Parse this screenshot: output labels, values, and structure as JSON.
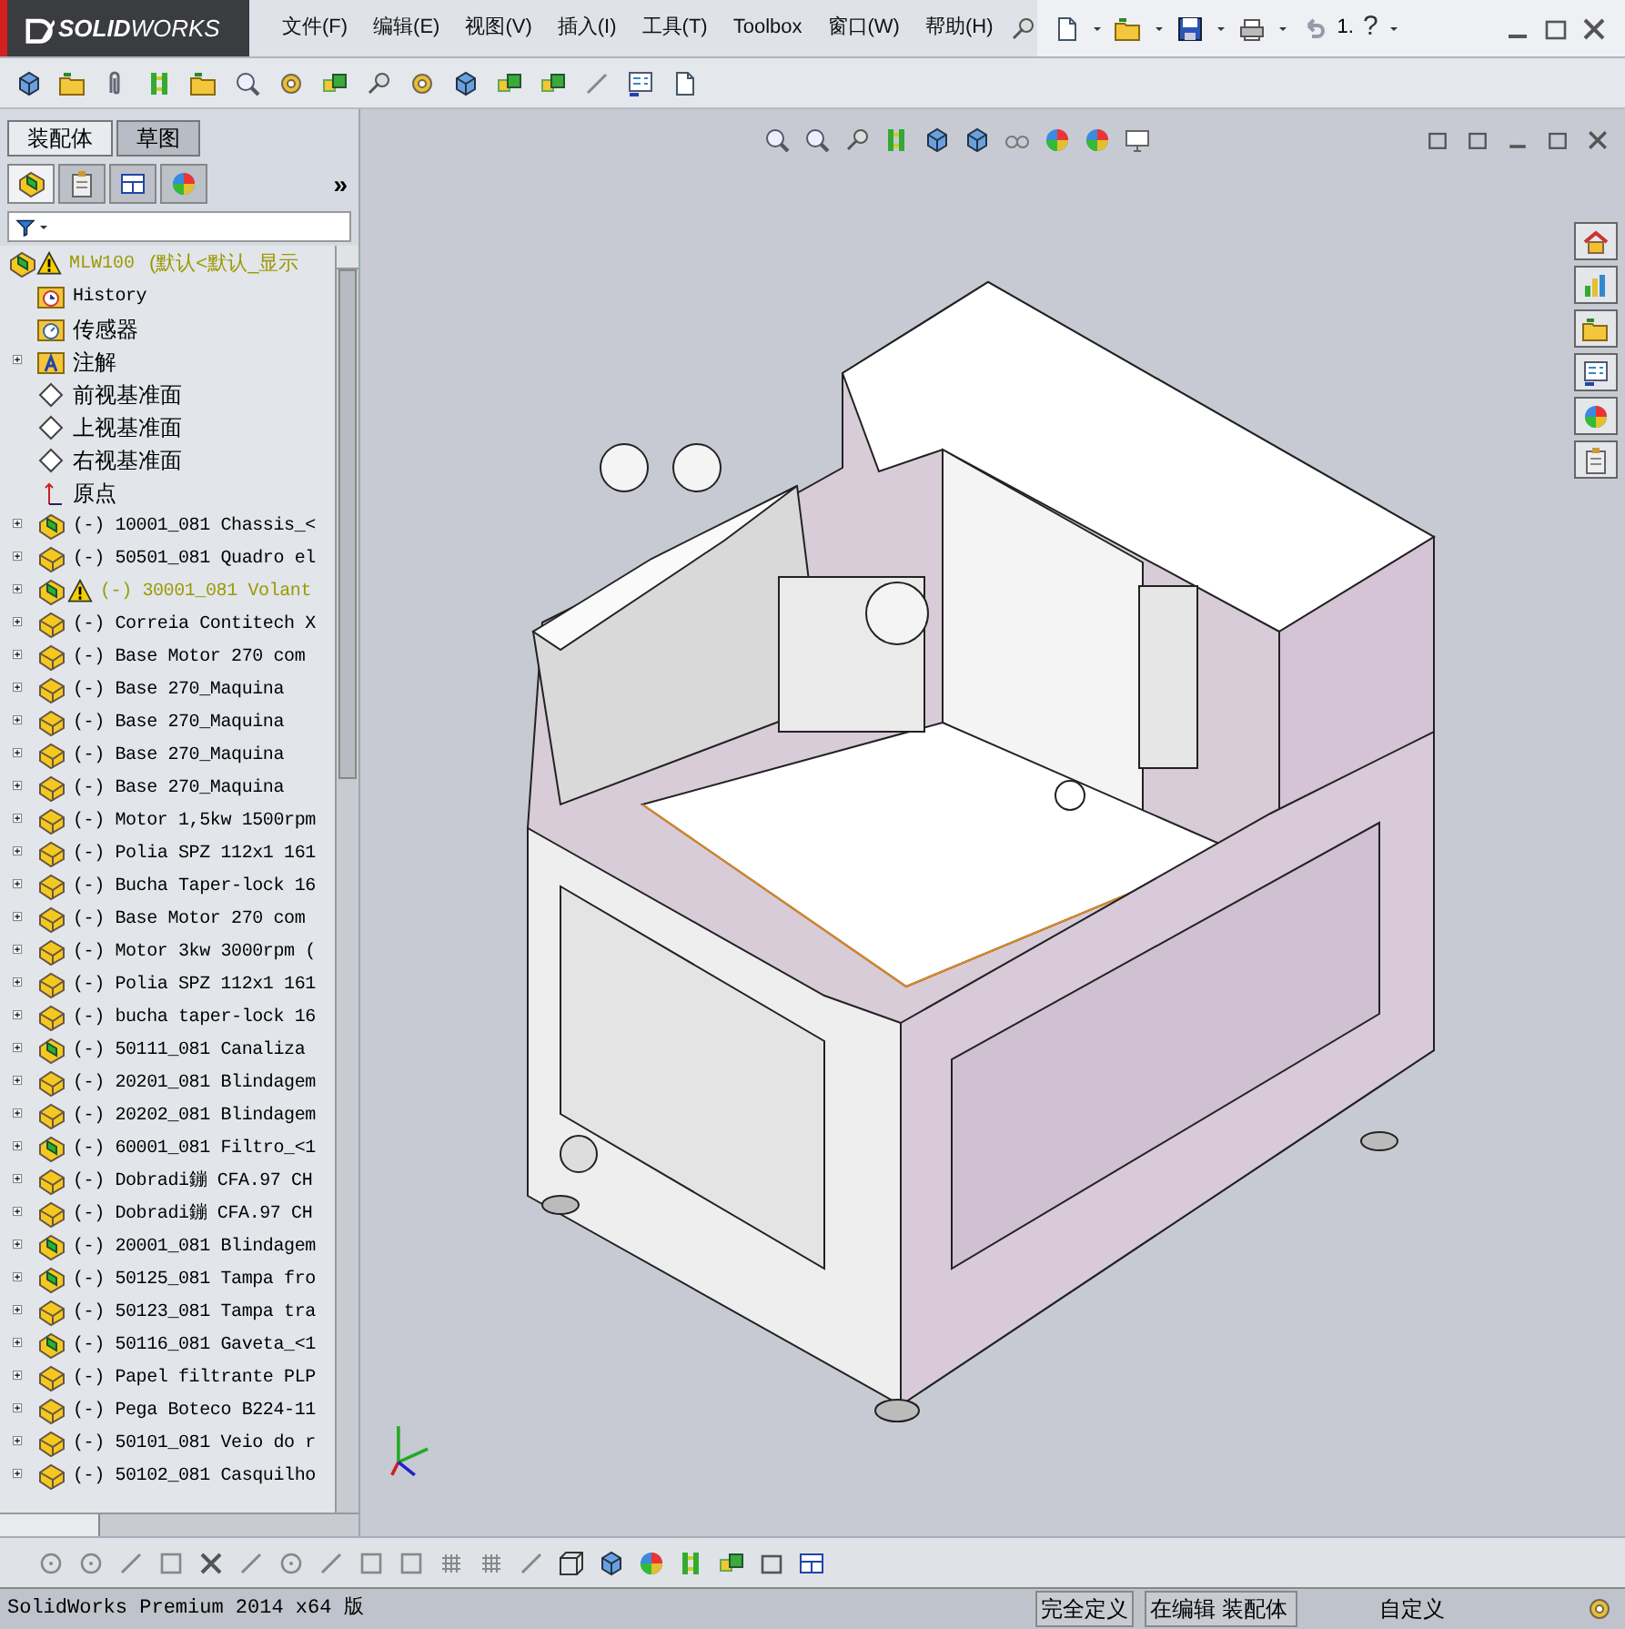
{
  "window": {
    "logo": "**SOLID**WORKS"
  },
  "menu": [
    "文件(F)",
    "编辑(E)",
    "视图(V)",
    "插入(I)",
    "工具(T)",
    "Toolbox",
    "窗口(W)",
    "帮助(H)"
  ],
  "quick_access": {
    "recent": "1.",
    "help": "?"
  },
  "panel_tabs": [
    {
      "label": "装配体",
      "selected": true
    },
    {
      "label": "草图",
      "selected": false
    }
  ],
  "manager_tabs": [
    {
      "selected": true
    },
    {
      "selected": false
    },
    {
      "selected": false
    },
    {
      "selected": false
    }
  ],
  "manager_more": "»",
  "tree": {
    "root": {
      "label": "MLW100",
      "config": "(默认<默认_显示",
      "warning": true
    },
    "items": [
      {
        "kind": "history",
        "label": "History",
        "expandable": false,
        "warning": false
      },
      {
        "kind": "sensor",
        "label": "传感器",
        "expandable": false,
        "warning": false
      },
      {
        "kind": "annotation",
        "label": "注解",
        "expandable": true,
        "warning": false
      },
      {
        "kind": "plane",
        "label": "前视基准面",
        "expandable": false,
        "warning": false
      },
      {
        "kind": "plane",
        "label": "上视基准面",
        "expandable": false,
        "warning": false
      },
      {
        "kind": "plane",
        "label": "右视基准面",
        "expandable": false,
        "warning": false
      },
      {
        "kind": "origin",
        "label": "原点",
        "expandable": false,
        "warning": false
      },
      {
        "kind": "assembly",
        "label": "(-) 10001_081 Chassis_<",
        "expandable": true,
        "warning": false
      },
      {
        "kind": "part",
        "label": "(-) 50501_081 Quadro el",
        "expandable": true,
        "warning": false
      },
      {
        "kind": "assembly",
        "label": "(-) 30001_081 Volant",
        "expandable": true,
        "warning": true
      },
      {
        "kind": "part",
        "label": "(-) Correia Contitech X",
        "expandable": true,
        "warning": false
      },
      {
        "kind": "part",
        "label": "(-) Base Motor 270 com",
        "expandable": true,
        "warning": false
      },
      {
        "kind": "part",
        "label": "(-) Base  270_Maquina",
        "expandable": true,
        "warning": false
      },
      {
        "kind": "part",
        "label": "(-) Base  270_Maquina",
        "expandable": true,
        "warning": false
      },
      {
        "kind": "part",
        "label": "(-) Base  270_Maquina",
        "expandable": true,
        "warning": false
      },
      {
        "kind": "part",
        "label": "(-) Base  270_Maquina",
        "expandable": true,
        "warning": false
      },
      {
        "kind": "part",
        "label": "(-) Motor 1,5kw 1500rpm",
        "expandable": true,
        "warning": false
      },
      {
        "kind": "part",
        "label": "(-) Polia SPZ 112x1 161",
        "expandable": true,
        "warning": false
      },
      {
        "kind": "part",
        "label": "(-) Bucha Taper-lock 16",
        "expandable": true,
        "warning": false
      },
      {
        "kind": "part",
        "label": "(-) Base Motor 270 com",
        "expandable": true,
        "warning": false
      },
      {
        "kind": "part",
        "label": "(-) Motor 3kw 3000rpm (",
        "expandable": true,
        "warning": false
      },
      {
        "kind": "part",
        "label": "(-) Polia SPZ 112x1 161",
        "expandable": true,
        "warning": false
      },
      {
        "kind": "part",
        "label": "(-) bucha taper-lock 16",
        "expandable": true,
        "warning": false
      },
      {
        "kind": "assembly",
        "label": "(-) 50111_081 Canaliza",
        "expandable": true,
        "warning": false
      },
      {
        "kind": "part",
        "label": "(-) 20201_081 Blindagem",
        "expandable": true,
        "warning": false
      },
      {
        "kind": "part",
        "label": "(-) 20202_081 Blindagem",
        "expandable": true,
        "warning": false
      },
      {
        "kind": "assembly",
        "label": "(-) 60001_081 Filtro_<1",
        "expandable": true,
        "warning": false
      },
      {
        "kind": "part",
        "label": "(-) Dobradi鏰 CFA.97 CH",
        "expandable": true,
        "warning": false
      },
      {
        "kind": "part",
        "label": "(-) Dobradi鏰 CFA.97 CH",
        "expandable": true,
        "warning": false
      },
      {
        "kind": "assembly",
        "label": "(-) 20001_081 Blindagem",
        "expandable": true,
        "warning": false
      },
      {
        "kind": "assembly",
        "label": "(-) 50125_081 Tampa fro",
        "expandable": true,
        "warning": false
      },
      {
        "kind": "part",
        "label": "(-) 50123_081 Tampa tra",
        "expandable": true,
        "warning": false
      },
      {
        "kind": "assembly",
        "label": "(-) 50116_081 Gaveta_<1",
        "expandable": true,
        "warning": false
      },
      {
        "kind": "part",
        "label": "(-) Papel filtrante PLP",
        "expandable": true,
        "warning": false
      },
      {
        "kind": "part",
        "label": "(-) Pega Boteco B224-11",
        "expandable": true,
        "warning": false
      },
      {
        "kind": "part",
        "label": "(-) 50101_081 Veio do r",
        "expandable": true,
        "warning": false
      },
      {
        "kind": "part",
        "label": "(-) 50102_081 Casquilho",
        "expandable": true,
        "warning": false
      }
    ]
  },
  "status_bar": {
    "product": "SolidWorks Premium 2014 x64 版",
    "definition": "完全定义",
    "editing": "在编辑 装配体",
    "units": "自定义"
  }
}
